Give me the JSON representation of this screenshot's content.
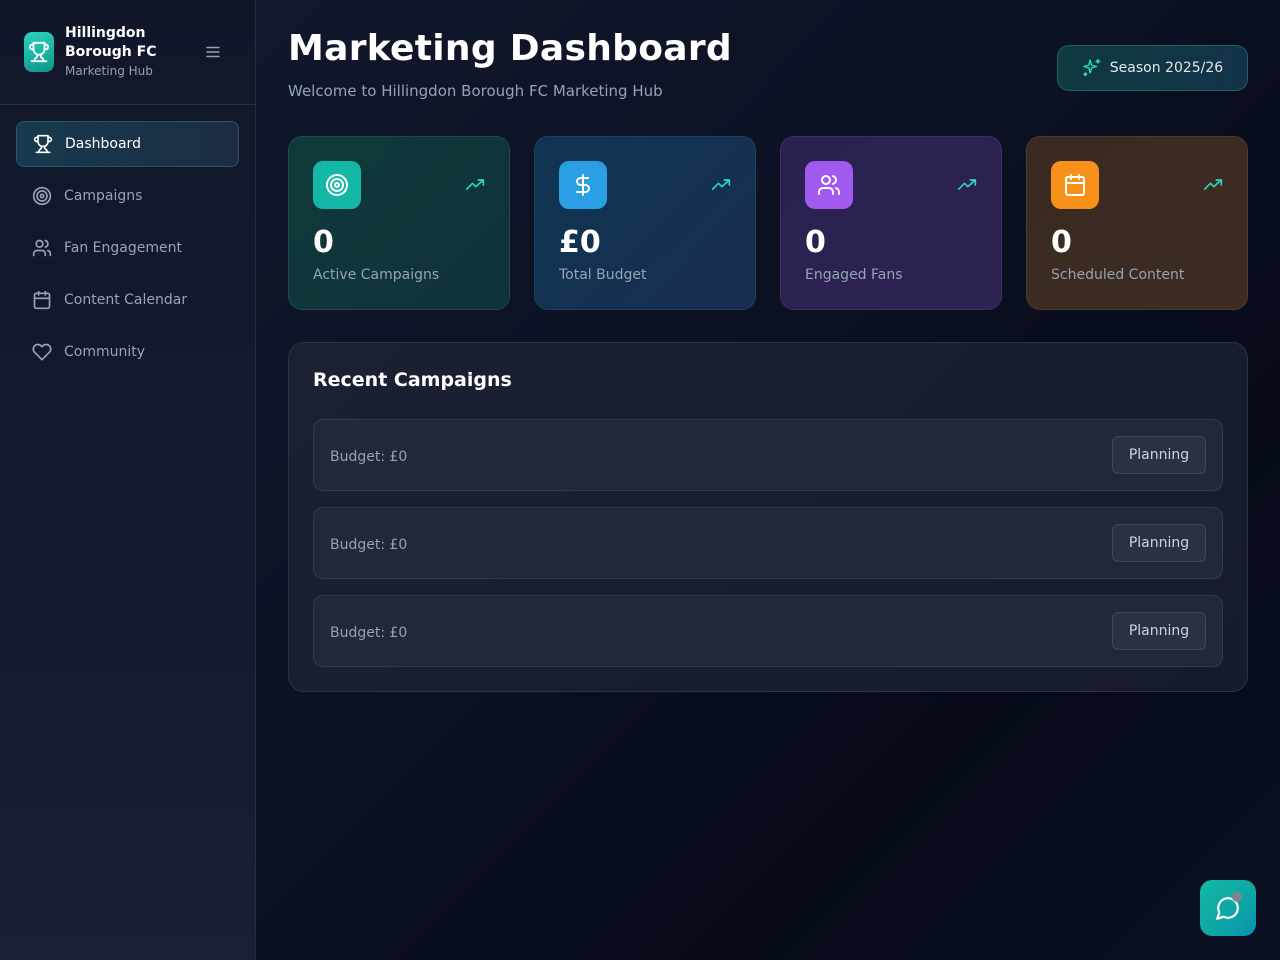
{
  "brand": {
    "name": "Hillingdon Borough FC",
    "subtitle": "Marketing Hub",
    "logo_icon": "trophy-icon"
  },
  "sidebar": {
    "menu_icon": "menu-icon",
    "items": [
      {
        "label": "Dashboard",
        "icon": "trophy-icon",
        "active": true
      },
      {
        "label": "Campaigns",
        "icon": "target-icon",
        "active": false
      },
      {
        "label": "Fan Engagement",
        "icon": "users-icon",
        "active": false
      },
      {
        "label": "Content Calendar",
        "icon": "calendar-icon",
        "active": false
      },
      {
        "label": "Community",
        "icon": "heart-icon",
        "active": false
      }
    ]
  },
  "header": {
    "title": "Marketing Dashboard",
    "subtitle": "Welcome to Hillingdon Borough FC Marketing Hub",
    "season_label": "Season 2025/26",
    "season_icon": "sparkles-icon"
  },
  "stats": [
    {
      "value": "0",
      "label": "Active Campaigns",
      "icon": "target-icon",
      "color": "#14b8a6"
    },
    {
      "value": "£0",
      "label": "Total Budget",
      "icon": "dollar-icon",
      "color": "#2b9fe6"
    },
    {
      "value": "0",
      "label": "Engaged Fans",
      "icon": "users-icon",
      "color": "#a259f0"
    },
    {
      "value": "0",
      "label": "Scheduled Content",
      "icon": "calendar-icon",
      "color": "#f7911a"
    }
  ],
  "recent": {
    "title": "Recent Campaigns",
    "items": [
      {
        "budget": "Budget: £0",
        "status": "Planning"
      },
      {
        "budget": "Budget: £0",
        "status": "Planning"
      },
      {
        "budget": "Budget: £0",
        "status": "Planning"
      }
    ]
  },
  "chat": {
    "icon": "chat-icon"
  },
  "colors": {
    "accent": "#14b8a6",
    "trend": "#2dd4bf"
  }
}
